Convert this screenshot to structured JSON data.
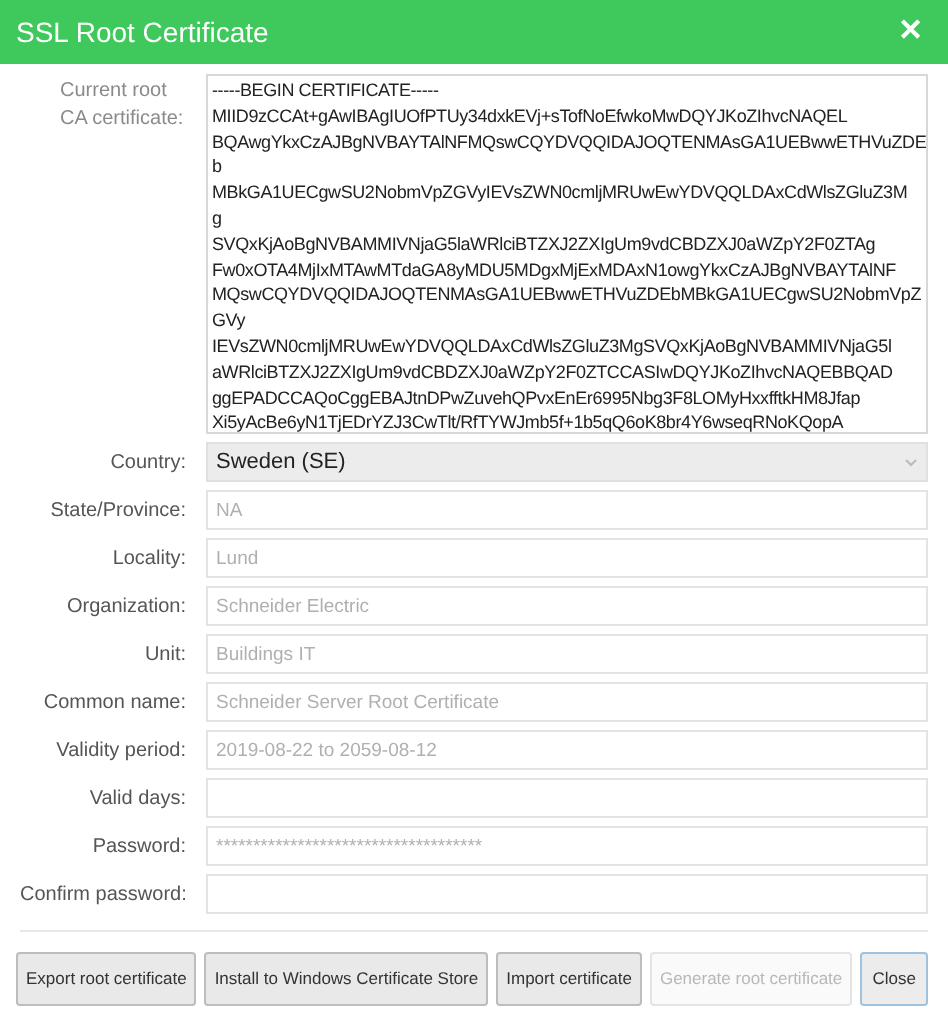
{
  "window": {
    "title": "SSL Root Certificate",
    "close": "✕"
  },
  "certificate": {
    "label": "Current root CA certificate:",
    "lines": [
      "-----BEGIN CERTIFICATE-----",
      "MIID9zCCAt+gAwIBAgIUOfPTUy34dxkEVj+sTofNoEfwkoMwDQYJKoZIhvcNAQEL",
      "BQAwgYkxCzAJBgNVBAYTAlNFMQswCQYDVQQIDAJOQTENMAsGA1UEBwwETHVuZDE",
      "b",
      "MBkGA1UECgwSU2NobmVpZGVyIEVsZWN0cmljMRUwEwYDVQQLDAxCdWlsZGluZ3M",
      "g",
      "SVQxKjAoBgNVBAMMIVNjaG5laWRlciBTZXJ2ZXIgUm9vdCBDZXJ0aWZpY2F0ZTAg",
      "Fw0xOTA4MjIxMTAwMTdaGA8yMDU5MDgxMjExMDAxN1owgYkxCzAJBgNVBAYTAlNF",
      "MQswCQYDVQQIDAJOQTENMAsGA1UEBwwETHVuZDEbMBkGA1UECgwSU2NobmVpZ",
      "GVy",
      "IEVsZWN0cmljMRUwEwYDVQQLDAxCdWlsZGluZ3MgSVQxKjAoBgNVBAMMIVNjaG5l",
      "aWRlciBTZXJ2ZXIgUm9vdCBDZXJ0aWZpY2F0ZTCCASIwDQYJKoZIhvcNAQEBBQAD",
      "ggEPADCCAQoCggEBAJtnDPwZuvehQPvxEnEr6995Nbg3F8LOMyHxxfftkHM8Jfap",
      "Xi5yAcBe6yN1TjEDrYZJ3CwTlt/RfTYWJmb5f+1b5qQ6oK8br4Y6wseqRNoKQopA"
    ]
  },
  "fields": [
    {
      "kind": "select",
      "label": "Country:",
      "value": "Sweden (SE)"
    },
    {
      "kind": "text",
      "label": "State/Province:",
      "placeholder": "NA"
    },
    {
      "kind": "text",
      "label": "Locality:",
      "placeholder": "Lund"
    },
    {
      "kind": "text",
      "label": "Organization:",
      "placeholder": "Schneider Electric"
    },
    {
      "kind": "text",
      "label": "Unit:",
      "placeholder": "Buildings IT"
    },
    {
      "kind": "text",
      "label": "Common name:",
      "placeholder": "Schneider Server Root Certificate"
    },
    {
      "kind": "text",
      "label": "Validity period:",
      "placeholder": "2019-08-22 to 2059-08-12"
    },
    {
      "kind": "text",
      "label": "Valid days:"
    },
    {
      "kind": "text",
      "label": "Password:",
      "placeholder": "************************************"
    },
    {
      "kind": "text",
      "label": "Confirm password:"
    }
  ],
  "buttons": [
    {
      "label": "Export root certificate",
      "disabled": false,
      "default": false
    },
    {
      "label": "Install to Windows Certificate Store",
      "disabled": false,
      "default": false
    },
    {
      "label": "Import certificate",
      "disabled": false,
      "default": false
    },
    {
      "label": "Generate root certificate",
      "disabled": true,
      "default": false
    },
    {
      "label": "Close",
      "disabled": false,
      "default": true
    }
  ]
}
